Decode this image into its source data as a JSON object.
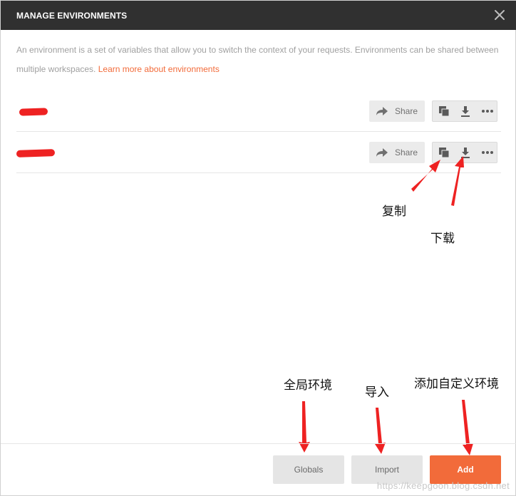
{
  "dialog": {
    "title": "MANAGE ENVIRONMENTS",
    "description": "An environment is a set of variables that allow you to switch the context of your requests. Environments can be shared between multiple workspaces. ",
    "learn_more": "Learn more about environments"
  },
  "environments": [
    {
      "name": "",
      "share_label": "Share"
    },
    {
      "name": "",
      "share_label": "Share"
    }
  ],
  "annotations": {
    "copy": "复制",
    "download": "下载",
    "globals": "全局环境",
    "import": "导入",
    "add": "添加自定义环境"
  },
  "footer": {
    "globals_label": "Globals",
    "import_label": "Import",
    "add_label": "Add"
  },
  "colors": {
    "accent": "#f26b3a",
    "header_bg": "#303030",
    "annotation_arrow": "#ee2222"
  },
  "watermark": "https://keepgoon.blog.csdn.net"
}
